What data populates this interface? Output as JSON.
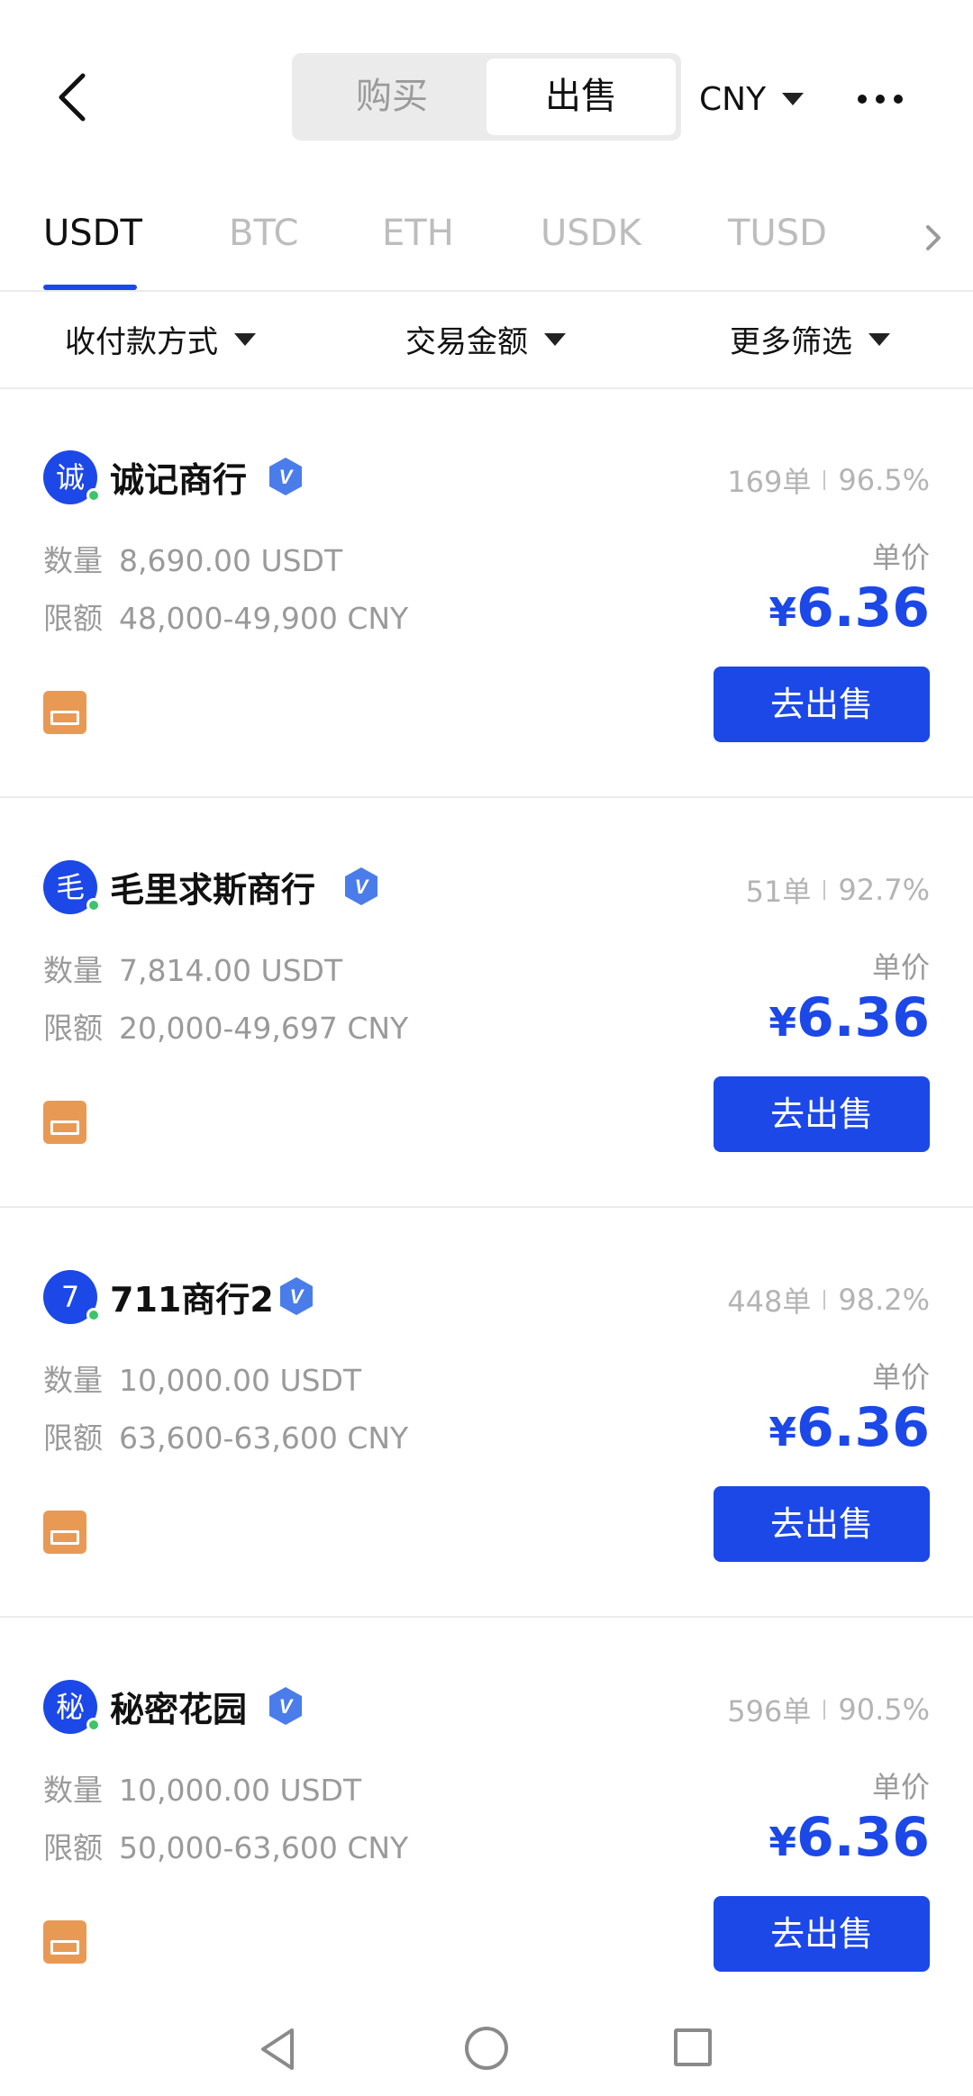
{
  "header": {
    "tabs": [
      {
        "label": "购买",
        "active": false
      },
      {
        "label": "出售",
        "active": true
      }
    ],
    "currency": "CNY"
  },
  "coin_tabs": [
    {
      "label": "USDT",
      "active": true
    },
    {
      "label": "BTC",
      "active": false
    },
    {
      "label": "ETH",
      "active": false
    },
    {
      "label": "USDK",
      "active": false
    },
    {
      "label": "TUSD",
      "active": false
    }
  ],
  "filters": [
    {
      "label": "收付款方式"
    },
    {
      "label": "交易金额"
    },
    {
      "label": "更多筛选"
    }
  ],
  "listings": [
    {
      "avatar_char": "诚",
      "name": "诚记商行",
      "orders": "169单",
      "rate": "96.5%",
      "qty_label": "数量",
      "qty": "8,690.00 USDT",
      "limit_label": "限额",
      "limit": "48,000-49,900 CNY",
      "price_label": "单价",
      "currency_symbol": "¥",
      "price": "6.36",
      "button": "去出售"
    },
    {
      "avatar_char": "毛",
      "name": "毛里求斯商行",
      "orders": "51单",
      "rate": "92.7%",
      "qty_label": "数量",
      "qty": "7,814.00 USDT",
      "limit_label": "限额",
      "limit": "20,000-49,697 CNY",
      "price_label": "单价",
      "currency_symbol": "¥",
      "price": "6.36",
      "button": "去出售"
    },
    {
      "avatar_char": "7",
      "name": "711商行2",
      "orders": "448单",
      "rate": "98.2%",
      "qty_label": "数量",
      "qty": "10,000.00 USDT",
      "limit_label": "限额",
      "limit": "63,600-63,600 CNY",
      "price_label": "单价",
      "currency_symbol": "¥",
      "price": "6.36",
      "button": "去出售"
    },
    {
      "avatar_char": "秘",
      "name": "秘密花园",
      "orders": "596单",
      "rate": "90.5%",
      "qty_label": "数量",
      "qty": "10,000.00 USDT",
      "limit_label": "限额",
      "limit": "50,000-63,600 CNY",
      "price_label": "单价",
      "currency_symbol": "¥",
      "price": "6.36",
      "button": "去出售"
    }
  ],
  "icons": {
    "back": "back-chevron-icon",
    "more": "more-dots-icon",
    "verified": "verified-badge-icon",
    "payment": "bank-card-icon"
  },
  "colors": {
    "accent": "#1c48e8",
    "payment_icon": "#e89a55",
    "online": "#3cc46b"
  }
}
